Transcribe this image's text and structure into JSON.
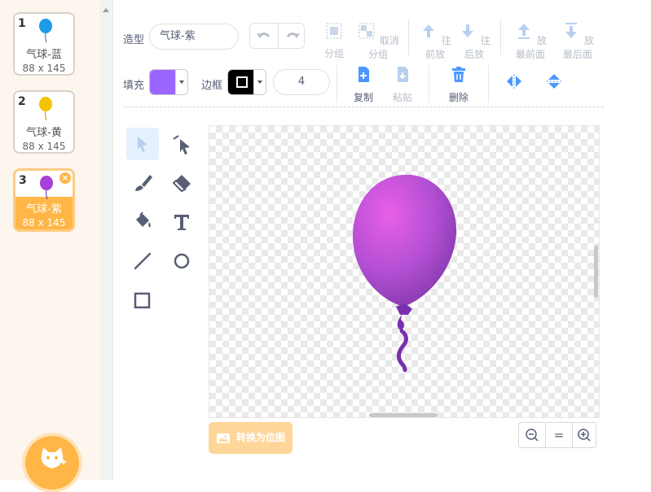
{
  "costumes": [
    {
      "number": "1",
      "name": "气球-蓝",
      "size": "88 x 145",
      "color": "#1e9be8"
    },
    {
      "number": "2",
      "name": "气球-黄",
      "size": "88 x 145",
      "color": "#f5c400"
    },
    {
      "number": "3",
      "name": "气球-紫",
      "size": "88 x 145",
      "color": "#a83fd6",
      "selected": true
    }
  ],
  "delete_glyph": "×",
  "costume_label": "造型",
  "costume_name_value": "气球-紫",
  "fill_label": "填充",
  "fill_color": "#9966ff",
  "outline_label": "边框",
  "outline_color": "#000000",
  "outline_width_value": "4",
  "toolbar": {
    "group": "分组",
    "ungroup": "取消分组",
    "forward": "往前放",
    "backward": "往后放",
    "front": "放最前面",
    "back": "放最后面",
    "copy": "复制",
    "paste": "粘贴",
    "delete": "删除"
  },
  "tools": [
    "select-icon",
    "reshape-icon",
    "brush-icon",
    "eraser-icon",
    "fill-icon",
    "text-icon",
    "line-icon",
    "circle-icon",
    "rectangle-icon"
  ],
  "convert_button": "转换为位图",
  "zoom_reset_glyph": "=",
  "accent_color": "#4c97ff",
  "orange_color": "#ffb646"
}
